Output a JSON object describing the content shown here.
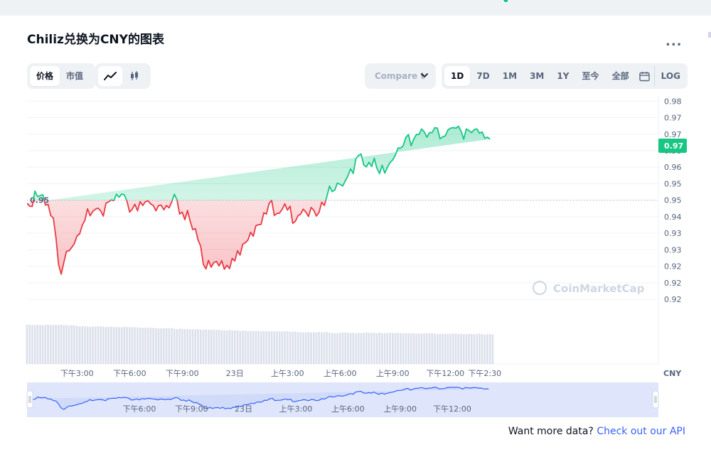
{
  "title": "Chiliz兑换为CNY的图表",
  "more_label": "...",
  "view_toggle": {
    "price_label": "价格",
    "mcap_label": "市值",
    "active": "价格"
  },
  "chart_mode": {
    "active": "line",
    "icons": [
      "line-chart-icon",
      "candlestick-icon"
    ]
  },
  "compare": {
    "label": "Compare t"
  },
  "ranges": {
    "items": [
      "1D",
      "7D",
      "1M",
      "3M",
      "1Y",
      "至今",
      "全部"
    ],
    "active": "1D",
    "calendar_icon": "calendar-icon",
    "log_label": "LOG"
  },
  "api_prompt": {
    "text": "Want more data?",
    "link": "Check out our API"
  },
  "colors": {
    "up": "#16c784",
    "down": "#ea3943",
    "accent": "#3861fb",
    "volume": "#cfd6e4",
    "navigator_fill": "#dfe6fc"
  },
  "chart_data": {
    "type": "line",
    "currency": "CNY",
    "watermark": "CoinMarketCap",
    "reference_value": 0.95,
    "reference_label": "0.95",
    "current_value": 0.9665,
    "current_label": "0.97",
    "ylim": [
      0.9155,
      0.9805
    ],
    "y_tick_values": [
      0.98,
      0.975,
      0.97,
      0.965,
      0.96,
      0.955,
      0.95,
      0.945,
      0.94,
      0.935,
      0.93,
      0.925,
      0.92
    ],
    "y_tick_labels": [
      "0.98",
      "0.97",
      "0.97",
      "0.96",
      "0.96",
      "0.95",
      "0.95",
      "0.94",
      "0.93",
      "0.93",
      "0.92",
      "0.92",
      "0.92"
    ],
    "xlim": [
      0,
      24
    ],
    "x_ticks": [
      {
        "t": 1.9,
        "label": "下午3:00"
      },
      {
        "t": 3.9,
        "label": "下午6:00"
      },
      {
        "t": 5.9,
        "label": "下午9:00"
      },
      {
        "t": 7.9,
        "label": "23日"
      },
      {
        "t": 9.9,
        "label": "上午3:00"
      },
      {
        "t": 11.9,
        "label": "上午6:00"
      },
      {
        "t": 13.9,
        "label": "上午9:00"
      },
      {
        "t": 15.9,
        "label": "下午12:00"
      },
      {
        "t": 17.4,
        "label": "下午2:30"
      }
    ],
    "navigator_ticks": [
      {
        "t": 4.2,
        "label": "下午6:00"
      },
      {
        "t": 6.2,
        "label": "下午9:00"
      },
      {
        "t": 8.2,
        "label": "23日"
      },
      {
        "t": 10.2,
        "label": "上午3:00"
      },
      {
        "t": 12.2,
        "label": "上午6:00"
      },
      {
        "t": 14.2,
        "label": "上午9:00"
      },
      {
        "t": 16.2,
        "label": "下午12:00"
      }
    ],
    "series": [
      {
        "t": [
          0.0,
          0.1,
          0.2,
          0.3,
          0.4,
          0.5,
          0.6,
          0.7,
          0.8,
          0.9,
          1.0,
          1.1,
          1.2,
          1.3,
          1.4,
          1.5,
          1.6,
          1.7,
          1.8,
          1.9,
          2.0,
          2.1,
          2.2,
          2.3,
          2.4,
          2.5,
          2.6,
          2.7,
          2.8,
          2.9,
          3.0,
          3.1,
          3.2,
          3.3,
          3.4,
          3.5,
          3.6,
          3.7,
          3.8,
          3.9,
          4.0,
          4.1,
          4.2,
          4.3,
          4.4,
          4.5,
          4.6,
          4.7,
          4.8,
          4.9,
          5.0,
          5.1,
          5.2,
          5.3,
          5.4,
          5.5,
          5.6,
          5.7,
          5.8,
          5.9,
          6.0,
          6.1,
          6.2,
          6.3,
          6.4,
          6.5,
          6.6,
          6.7,
          6.8,
          6.9,
          7.0,
          7.1,
          7.2,
          7.3,
          7.4,
          7.5,
          7.6,
          7.7,
          7.8,
          7.9,
          8.0,
          8.1,
          8.2,
          8.3,
          8.4,
          8.5,
          8.6,
          8.7,
          8.8,
          8.9,
          9.0,
          9.1,
          9.2,
          9.3,
          9.4,
          9.5,
          9.6,
          9.7,
          9.8,
          9.9,
          10.0,
          10.1,
          10.2,
          10.3,
          10.4,
          10.5,
          10.6,
          10.7,
          10.8,
          10.9,
          11.0,
          11.1,
          11.2,
          11.3,
          11.4,
          11.5,
          11.6,
          11.7,
          11.8,
          11.9,
          12.0,
          12.1,
          12.2,
          12.3,
          12.4,
          12.5,
          12.6,
          12.7,
          12.8,
          12.9,
          13.0,
          13.1,
          13.2,
          13.3,
          13.4,
          13.5,
          13.6,
          13.7,
          13.8,
          13.9,
          14.0,
          14.1,
          14.2,
          14.3,
          14.4,
          14.5,
          14.6,
          14.7,
          14.8,
          14.9,
          15.0,
          15.1,
          15.2,
          15.3,
          15.4,
          15.5,
          15.6,
          15.7,
          15.8,
          15.9,
          16.0,
          16.1,
          16.2,
          16.3,
          16.4,
          16.5,
          16.6,
          16.7,
          16.8,
          16.9,
          17.0,
          17.1,
          17.2,
          17.3,
          17.4,
          17.5,
          17.6,
          17.7,
          17.8,
          17.9,
          18.0,
          18.1,
          18.2
        ],
        "values": [
          0.9491,
          0.9482,
          0.9481,
          0.9528,
          0.9511,
          0.9514,
          0.9517,
          0.9485,
          0.9488,
          0.9454,
          0.9446,
          0.9387,
          0.9305,
          0.9276,
          0.9312,
          0.9345,
          0.9347,
          0.9357,
          0.9369,
          0.9392,
          0.9398,
          0.9424,
          0.9439,
          0.9474,
          0.9453,
          0.9466,
          0.9473,
          0.9476,
          0.9468,
          0.9452,
          0.9491,
          0.9495,
          0.9501,
          0.9499,
          0.9518,
          0.9509,
          0.9519,
          0.9516,
          0.9497,
          0.9464,
          0.9473,
          0.9488,
          0.9468,
          0.9496,
          0.9484,
          0.9496,
          0.9498,
          0.9489,
          0.9484,
          0.9468,
          0.9484,
          0.9485,
          0.9471,
          0.9484,
          0.9477,
          0.9495,
          0.9518,
          0.9502,
          0.9458,
          0.9464,
          0.9441,
          0.9469,
          0.9437,
          0.9411,
          0.9414,
          0.938,
          0.9361,
          0.9307,
          0.9292,
          0.9318,
          0.9297,
          0.9311,
          0.9315,
          0.9301,
          0.9317,
          0.9291,
          0.9303,
          0.9293,
          0.9324,
          0.9316,
          0.9347,
          0.9334,
          0.9367,
          0.9371,
          0.938,
          0.9403,
          0.9391,
          0.9423,
          0.9426,
          0.9427,
          0.9462,
          0.9458,
          0.949,
          0.95,
          0.9454,
          0.946,
          0.9461,
          0.9473,
          0.9489,
          0.947,
          0.9482,
          0.943,
          0.9436,
          0.9453,
          0.9458,
          0.9473,
          0.9464,
          0.9451,
          0.9478,
          0.947,
          0.9452,
          0.9463,
          0.9494,
          0.9484,
          0.9512,
          0.9543,
          0.9526,
          0.9531,
          0.9552,
          0.9548,
          0.9543,
          0.9559,
          0.9574,
          0.9595,
          0.9581,
          0.9625,
          0.9636,
          0.964,
          0.9607,
          0.9601,
          0.9615,
          0.9602,
          0.9627,
          0.9597,
          0.9581,
          0.9606,
          0.9582,
          0.96,
          0.9614,
          0.9622,
          0.9636,
          0.9658,
          0.9658,
          0.9665,
          0.969,
          0.9699,
          0.9665,
          0.9685,
          0.9699,
          0.9699,
          0.9716,
          0.9707,
          0.9691,
          0.9705,
          0.9705,
          0.972,
          0.9718,
          0.9686,
          0.9692,
          0.9695,
          0.9713,
          0.9718,
          0.972,
          0.9718,
          0.9724,
          0.9709,
          0.9685,
          0.9716,
          0.9711,
          0.9705,
          0.9714,
          0.9716,
          0.9703,
          0.9707,
          0.9688,
          0.9691,
          0.9685
        ]
      }
    ],
    "volume": {
      "t": [
        0.0,
        0.1,
        0.2,
        0.3,
        0.4,
        0.5,
        0.6,
        0.7,
        0.8,
        0.9,
        1.0,
        1.1,
        1.2,
        1.3,
        1.4,
        1.5,
        1.6,
        1.7,
        1.8,
        1.9,
        2.0,
        2.1,
        2.2,
        2.3,
        2.4,
        2.5,
        2.6,
        2.7,
        2.8,
        2.9,
        3.0,
        3.1,
        3.2,
        3.3,
        3.4,
        3.5,
        3.6,
        3.7,
        3.8,
        3.9,
        4.0,
        4.1,
        4.2,
        4.3,
        4.4,
        4.5,
        4.6,
        4.7,
        4.8,
        4.9,
        5.0,
        5.1,
        5.2,
        5.3,
        5.4,
        5.5,
        5.6,
        5.7,
        5.8,
        5.9,
        6.0,
        6.1,
        6.2,
        6.3,
        6.4,
        6.5,
        6.6,
        6.7,
        6.8,
        6.9,
        7.0,
        7.1,
        7.2,
        7.3,
        7.4,
        7.5,
        7.6,
        7.7,
        7.8,
        7.9,
        8.0,
        8.1,
        8.2,
        8.3,
        8.4,
        8.5,
        8.6,
        8.7,
        8.8,
        8.9,
        9.0,
        9.1,
        9.2,
        9.3,
        9.4,
        9.5,
        9.6,
        9.7,
        9.8,
        9.9,
        10.0,
        10.1,
        10.2,
        10.3,
        10.4,
        10.5,
        10.6,
        10.7,
        10.8,
        10.9,
        11.0,
        11.1,
        11.2,
        11.3,
        11.4,
        11.5,
        11.6,
        11.7,
        11.8,
        11.9,
        12.0,
        12.1,
        12.2,
        12.3,
        12.4,
        12.5,
        12.6,
        12.7,
        12.8,
        12.9,
        13.0,
        13.1,
        13.2,
        13.3,
        13.4,
        13.5,
        13.6,
        13.7,
        13.8,
        13.9,
        14.0,
        14.1,
        14.2,
        14.3,
        14.4,
        14.5,
        14.6,
        14.7,
        14.8,
        14.9,
        15.0,
        15.1,
        15.2,
        15.3,
        15.4,
        15.5,
        15.6,
        15.7,
        15.8,
        15.9,
        16.0,
        16.1,
        16.2,
        16.3,
        16.4,
        16.5,
        16.6,
        16.7,
        16.8,
        16.9,
        17.0,
        17.1,
        17.2,
        17.3,
        17.4,
        17.5,
        17.6,
        17.7,
        17.8,
        17.9,
        18.0,
        18.1
      ],
      "values": [
        0.968,
        0.964,
        0.962,
        0.958,
        0.965,
        0.96,
        0.955,
        0.962,
        0.974,
        0.957,
        0.962,
        0.963,
        0.961,
        0.97,
        0.955,
        0.966,
        0.946,
        0.956,
        0.951,
        0.935,
        0.929,
        0.933,
        0.927,
        0.922,
        0.921,
        0.922,
        0.92,
        0.928,
        0.926,
        0.922,
        0.912,
        0.918,
        0.92,
        0.914,
        0.911,
        0.906,
        0.906,
        0.914,
        0.909,
        0.907,
        0.905,
        0.903,
        0.902,
        0.893,
        0.891,
        0.894,
        0.891,
        0.891,
        0.888,
        0.885,
        0.878,
        0.878,
        0.877,
        0.883,
        0.881,
        0.885,
        0.866,
        0.861,
        0.873,
        0.864,
        0.859,
        0.856,
        0.855,
        0.854,
        0.852,
        0.856,
        0.847,
        0.844,
        0.848,
        0.844,
        0.842,
        0.841,
        0.839,
        0.843,
        0.826,
        0.831,
        0.822,
        0.841,
        0.826,
        0.827,
        0.826,
        0.813,
        0.818,
        0.821,
        0.812,
        0.812,
        0.807,
        0.815,
        0.815,
        0.799,
        0.815,
        0.809,
        0.805,
        0.807,
        0.804,
        0.802,
        0.803,
        0.8,
        0.805,
        0.807,
        0.792,
        0.797,
        0.799,
        0.784,
        0.784,
        0.78,
        0.775,
        0.787,
        0.775,
        0.781,
        0.778,
        0.79,
        0.778,
        0.784,
        0.789,
        0.77,
        0.761,
        0.764,
        0.763,
        0.763,
        0.776,
        0.774,
        0.768,
        0.763,
        0.769,
        0.758,
        0.766,
        0.764,
        0.769,
        0.778,
        0.768,
        0.763,
        0.772,
        0.761,
        0.775,
        0.758,
        0.758,
        0.76,
        0.772,
        0.764,
        0.76,
        0.766,
        0.762,
        0.756,
        0.757,
        0.758,
        0.752,
        0.755,
        0.748,
        0.749,
        0.754,
        0.752,
        0.751,
        0.757,
        0.755,
        0.743,
        0.74,
        0.745,
        0.741,
        0.744,
        0.741,
        0.743,
        0.746,
        0.751,
        0.732,
        0.741,
        0.731,
        0.736,
        0.74,
        0.738,
        0.734,
        0.733,
        0.747,
        0.736,
        0.722,
        0.733,
        0.736,
        0.724
      ]
    }
  }
}
